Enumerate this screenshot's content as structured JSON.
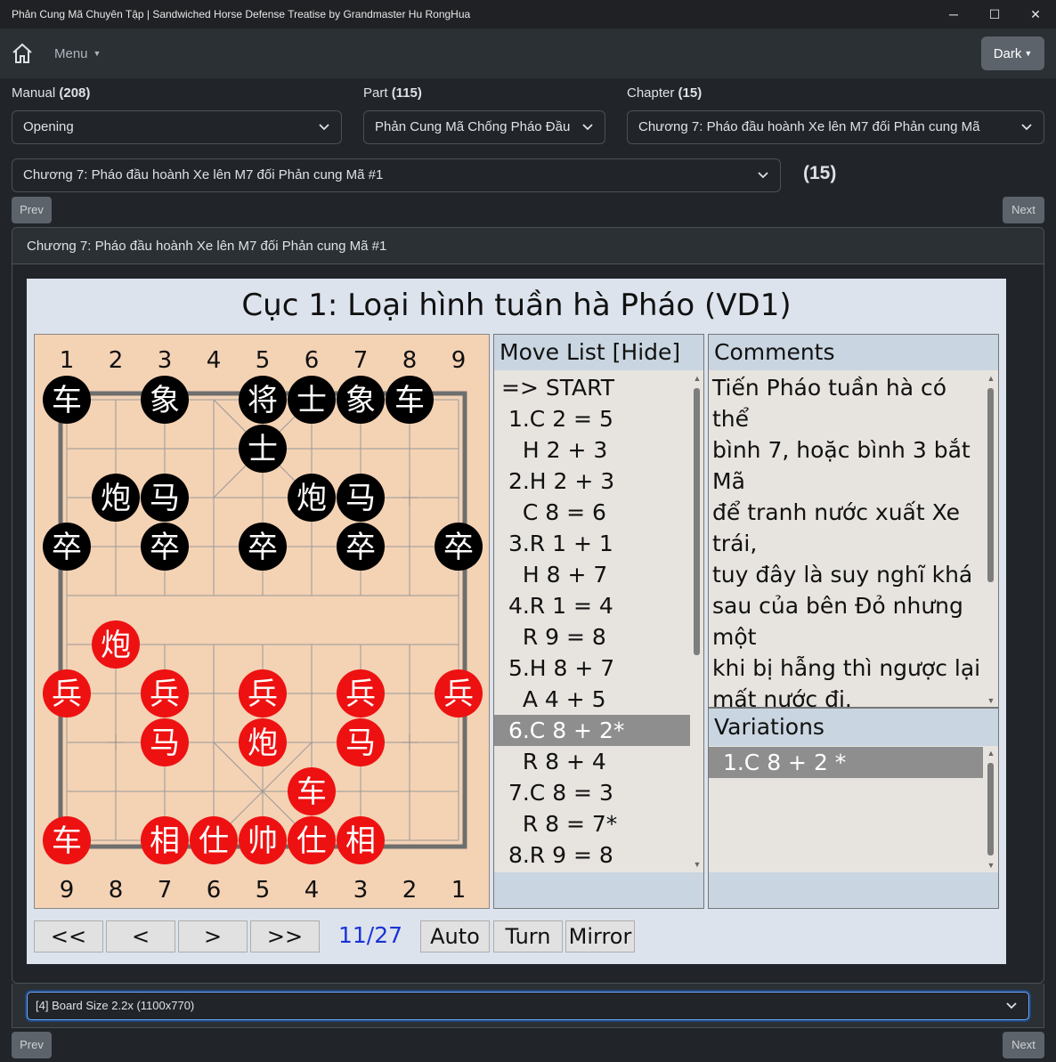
{
  "window": {
    "title": "Phản Cung Mã Chuyên Tập | Sandwiched Horse Defense Treatise by Grandmaster Hu RongHua",
    "minimize": "─",
    "maximize": "☐",
    "close": "✕"
  },
  "navbar": {
    "menu_label": "Menu",
    "theme_button": "Dark"
  },
  "filters": {
    "manual": {
      "label": "Manual",
      "count": "(208)",
      "value": "Opening"
    },
    "part": {
      "label": "Part",
      "count": "(115)",
      "value": "Phản Cung Mã Chống Pháo Đầu"
    },
    "chapter": {
      "label": "Chapter",
      "count": "(15)",
      "value": "Chương 7: Pháo đầu hoành Xe lên M7 đối Phản cung Mã"
    },
    "game": {
      "value": "Chương 7: Pháo đầu hoành Xe lên M7 đối Phản cung Mã #1",
      "count": "(15)"
    }
  },
  "pager": {
    "prev": "Prev",
    "next": "Next"
  },
  "card": {
    "header": "Chương 7: Pháo đầu hoành Xe lên M7 đối Phản cung Mã #1"
  },
  "viewer": {
    "title": "Cục 1: Loại hình tuần hà Pháo (VD1)",
    "top_files": [
      "1",
      "2",
      "3",
      "4",
      "5",
      "6",
      "7",
      "8",
      "9"
    ],
    "bottom_files": [
      "9",
      "8",
      "7",
      "6",
      "5",
      "4",
      "3",
      "2",
      "1"
    ],
    "pieces": [
      {
        "c": "b",
        "t": "车",
        "f": 0,
        "r": 0
      },
      {
        "c": "b",
        "t": "象",
        "f": 2,
        "r": 0
      },
      {
        "c": "b",
        "t": "将",
        "f": 4,
        "r": 0
      },
      {
        "c": "b",
        "t": "士",
        "f": 5,
        "r": 0
      },
      {
        "c": "b",
        "t": "象",
        "f": 6,
        "r": 0
      },
      {
        "c": "b",
        "t": "车",
        "f": 7,
        "r": 0
      },
      {
        "c": "b",
        "t": "士",
        "f": 4,
        "r": 1
      },
      {
        "c": "b",
        "t": "炮",
        "f": 1,
        "r": 2
      },
      {
        "c": "b",
        "t": "马",
        "f": 2,
        "r": 2
      },
      {
        "c": "b",
        "t": "炮",
        "f": 5,
        "r": 2
      },
      {
        "c": "b",
        "t": "马",
        "f": 6,
        "r": 2
      },
      {
        "c": "b",
        "t": "卒",
        "f": 0,
        "r": 3
      },
      {
        "c": "b",
        "t": "卒",
        "f": 2,
        "r": 3
      },
      {
        "c": "b",
        "t": "卒",
        "f": 4,
        "r": 3
      },
      {
        "c": "b",
        "t": "卒",
        "f": 6,
        "r": 3
      },
      {
        "c": "b",
        "t": "卒",
        "f": 8,
        "r": 3
      },
      {
        "c": "r",
        "t": "炮",
        "f": 1,
        "r": 5
      },
      {
        "c": "r",
        "t": "兵",
        "f": 0,
        "r": 6
      },
      {
        "c": "r",
        "t": "兵",
        "f": 2,
        "r": 6
      },
      {
        "c": "r",
        "t": "兵",
        "f": 4,
        "r": 6
      },
      {
        "c": "r",
        "t": "兵",
        "f": 6,
        "r": 6
      },
      {
        "c": "r",
        "t": "兵",
        "f": 8,
        "r": 6
      },
      {
        "c": "r",
        "t": "马",
        "f": 2,
        "r": 7
      },
      {
        "c": "r",
        "t": "炮",
        "f": 4,
        "r": 7
      },
      {
        "c": "r",
        "t": "马",
        "f": 6,
        "r": 7
      },
      {
        "c": "r",
        "t": "车",
        "f": 5,
        "r": 8
      },
      {
        "c": "r",
        "t": "车",
        "f": 0,
        "r": 9
      },
      {
        "c": "r",
        "t": "相",
        "f": 2,
        "r": 9
      },
      {
        "c": "r",
        "t": "仕",
        "f": 3,
        "r": 9
      },
      {
        "c": "r",
        "t": "帅",
        "f": 4,
        "r": 9
      },
      {
        "c": "r",
        "t": "仕",
        "f": 5,
        "r": 9
      },
      {
        "c": "r",
        "t": "相",
        "f": 6,
        "r": 9
      }
    ],
    "move_list": {
      "header": "Move List [Hide]",
      "moves": [
        "=> START",
        " 1.C 2 = 5",
        "   H 2 + 3",
        " 2.H 2 + 3",
        "   C 8 = 6",
        " 3.R 1 + 1",
        "   H 8 + 7",
        " 4.R 1 = 4",
        "   R 9 = 8",
        " 5.H 8 + 7",
        "   A 4 + 5",
        " 6.C 8 + 2*",
        "   R 8 + 4",
        " 7.C 8 = 3",
        "   R 8 = 7*",
        " 8.R 9 = 8"
      ],
      "selected_index": 11
    },
    "comments": {
      "header": "Comments",
      "lines": [
        "Tiến Pháo tuần hà có thể",
        "bình 7, hoặc bình 3 bắt Mã",
        "để tranh nước xuất Xe trái,",
        "tuy đây là suy nghĩ khá",
        "sau của bên Đỏ nhưng một",
        "khi bị hẫng thì ngược lại",
        "mất nước đi."
      ]
    },
    "variations": {
      "header": "Variations",
      "items": [
        " 1.C 8 + 2 *"
      ]
    },
    "controls": {
      "first": "<<",
      "prev": "<",
      "next": ">",
      "last": ">>",
      "counter": "11/27",
      "auto": "Auto",
      "turn": "Turn",
      "mirror": "Mirror"
    }
  },
  "board_size": {
    "value": "[4] Board Size 2.2x (1100x770)"
  },
  "colors": {
    "accent_blue": "#1a33d6",
    "red_piece": "#ee1111",
    "black_piece": "#000000",
    "board": "#f4d2b4"
  }
}
